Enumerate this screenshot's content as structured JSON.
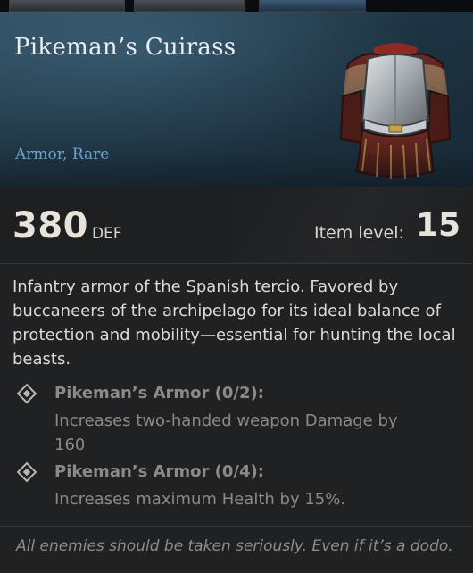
{
  "item": {
    "title": "Pikeman’s Cuirass",
    "type": "Armor, Rare",
    "icon": "cuirass-armor-icon"
  },
  "stats": {
    "defense_value": "380",
    "defense_label": "DEF",
    "item_level_label": "Item level:",
    "item_level_value": "15"
  },
  "description": "Infantry armor of the Spanish tercio. Favored by buccaneers of the archipelago for its ideal balance of protection and mobility—essential for hunting the local beasts.",
  "set_bonuses": [
    {
      "name": "Pikeman’s Armor (0/2):",
      "effect": "Increases two-handed weapon Damage by 160"
    },
    {
      "name": "Pikeman’s Armor (0/4):",
      "effect": "Increases maximum Health by 15%."
    }
  ],
  "flavor_text": "All enemies should be taken seriously. Even if it’s a dodo.",
  "colors": {
    "title": "#e8eef2",
    "rarity": "#6fa8d6",
    "inactive_set_text": "#8c8a86",
    "header_bg": "#1e3442"
  }
}
